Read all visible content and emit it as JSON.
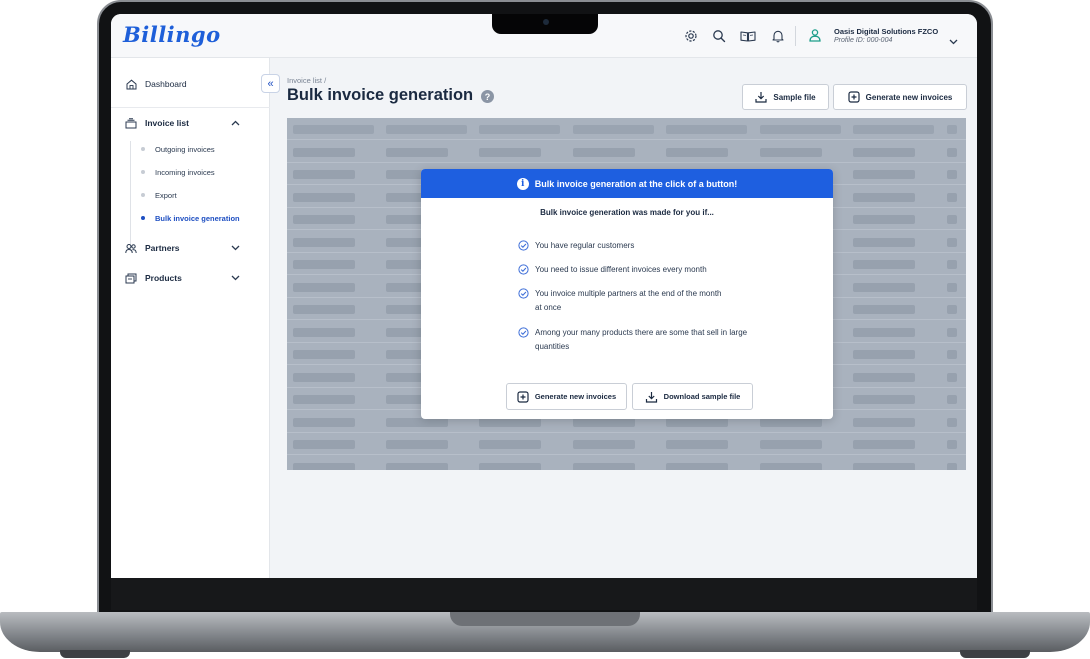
{
  "app": {
    "logo": "Billingo"
  },
  "topbar": {
    "icons": [
      "settings-icon",
      "search-icon",
      "book-icon",
      "bell-icon"
    ],
    "profile": {
      "company": "Oasis Digital Solutions FZCO",
      "profile_id": "Profile ID: 000-004"
    }
  },
  "sidebar": {
    "dashboard": "Dashboard",
    "invoice_list": "Invoice list",
    "sub_items": [
      {
        "label": "Outgoing invoices",
        "active": false
      },
      {
        "label": "Incoming invoices",
        "active": false
      },
      {
        "label": "Export",
        "active": false
      },
      {
        "label": "Bulk invoice generation",
        "active": true
      }
    ],
    "partners": "Partners",
    "products": "Products",
    "collapse_glyph": "«"
  },
  "main": {
    "breadcrumb": "Invoice list /",
    "title": "Bulk invoice generation",
    "help_glyph": "?",
    "sample_file_button": "Sample file",
    "generate_button": "Generate new invoices"
  },
  "modal": {
    "header": "Bulk invoice generation at the click of a button!",
    "info_glyph": "i",
    "subtitle": "Bulk invoice generation was made for you if...",
    "items": [
      "You have regular customers",
      "You need to issue different invoices every month",
      "You invoice multiple partners at the end of the month at once",
      "Among your many products there are some that sell in large quantities"
    ],
    "generate_button": "Generate new invoices",
    "download_button": "Download sample file"
  },
  "colors": {
    "accent": "#1e5fe0",
    "text": "#1b2a41",
    "overlay": "#a9b2be"
  }
}
